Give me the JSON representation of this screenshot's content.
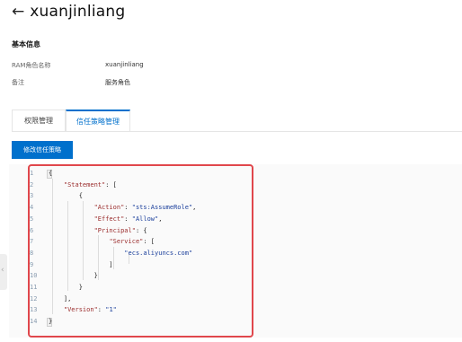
{
  "header": {
    "back_icon": "←",
    "title": "xuanjinliang"
  },
  "basic_info": {
    "section_title": "基本信息",
    "rows": [
      {
        "label": "RAM角色名称",
        "value": "xuanjinliang"
      },
      {
        "label": "备注",
        "value": "服务角色"
      }
    ]
  },
  "tabs": [
    {
      "label": "权限管理",
      "active": false
    },
    {
      "label": "信任策略管理",
      "active": true
    }
  ],
  "edit_button": {
    "label": "修改信任策略"
  },
  "scroll_handle": {
    "icon": "‹"
  },
  "code": {
    "lines": [
      {
        "num": "1",
        "text": "{"
      },
      {
        "num": "2",
        "text": "    \"Statement\": ["
      },
      {
        "num": "3",
        "text": "        {"
      },
      {
        "num": "4",
        "text": "            \"Action\": \"sts:AssumeRole\","
      },
      {
        "num": "5",
        "text": "            \"Effect\": \"Allow\","
      },
      {
        "num": "6",
        "text": "            \"Principal\": {"
      },
      {
        "num": "7",
        "text": "                \"Service\": ["
      },
      {
        "num": "8",
        "text": "                    \"ecs.aliyuncs.com\""
      },
      {
        "num": "9",
        "text": "                ]"
      },
      {
        "num": "10",
        "text": "            }"
      },
      {
        "num": "11",
        "text": "        }"
      },
      {
        "num": "12",
        "text": "    ],"
      },
      {
        "num": "13",
        "text": "    \"Version\": \"1\""
      },
      {
        "num": "14",
        "text": "}"
      }
    ]
  },
  "colors": {
    "accent": "#0070cc",
    "highlight_border": "#e0474c",
    "line_number": "#8a9cb0",
    "json_key": "#9b2d2d",
    "json_value": "#1a3e9b"
  }
}
